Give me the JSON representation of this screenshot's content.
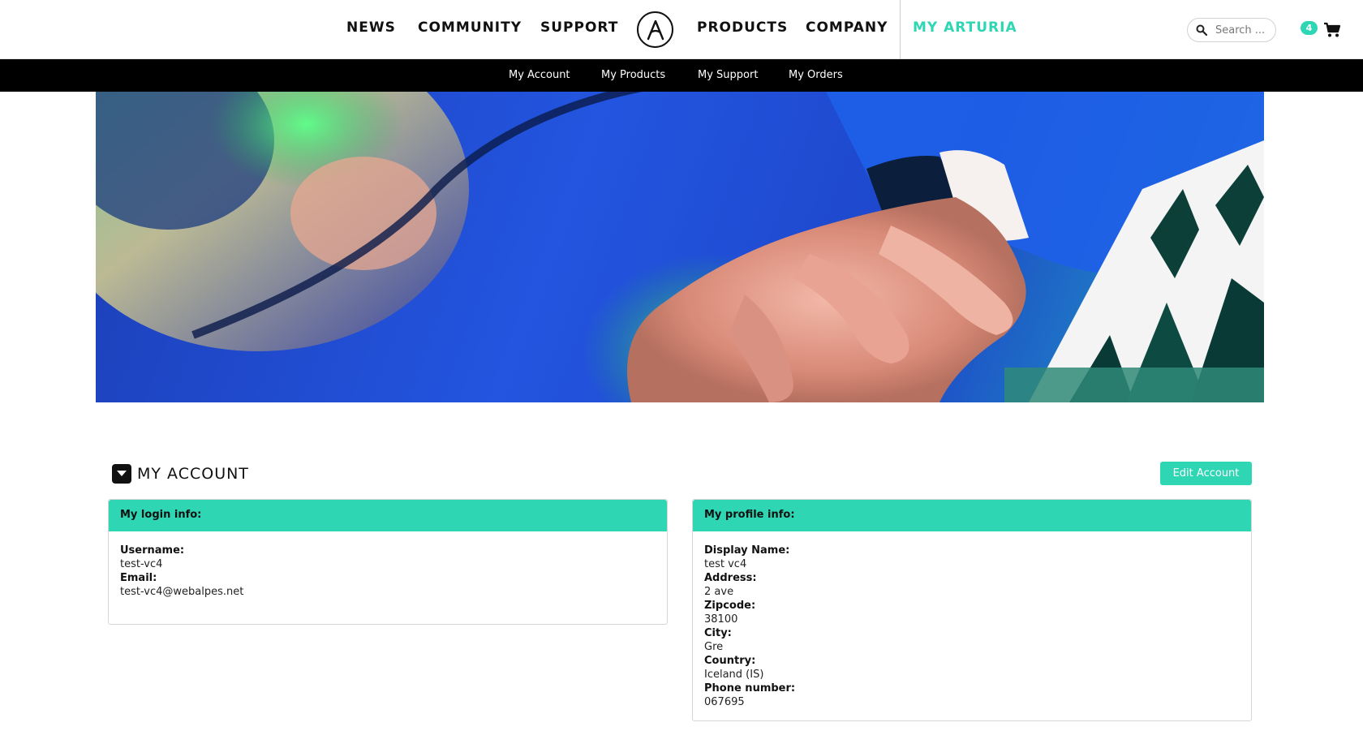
{
  "nav": {
    "items": [
      "NEWS",
      "COMMUNITY",
      "SUPPORT",
      "PRODUCTS",
      "COMPANY"
    ],
    "my_arturia": "MY ARTURIA"
  },
  "search": {
    "placeholder": "Search ..."
  },
  "cart": {
    "count": "4"
  },
  "subnav": {
    "items": [
      "My Account",
      "My Products",
      "My Support",
      "My Orders"
    ]
  },
  "section": {
    "title": "MY ACCOUNT",
    "edit_button": "Edit Account"
  },
  "login_panel": {
    "title": "My login info:",
    "username_label": "Username:",
    "username": "test-vc4",
    "email_label": "Email:",
    "email": "test-vc4@webalpes.net"
  },
  "profile_panel": {
    "title": "My profile info:",
    "display_name_label": "Display Name:",
    "display_name": "test vc4",
    "address_label": "Address:",
    "address": "2 ave",
    "zipcode_label": "Zipcode:",
    "zipcode": "38100",
    "city_label": "City:",
    "city": "Gre",
    "country_label": "Country:",
    "country": "Iceland (IS)",
    "phone_label": "Phone number:",
    "phone": "067695"
  },
  "colors": {
    "accent": "#2ed6b4",
    "subnav_bg": "#000000"
  }
}
